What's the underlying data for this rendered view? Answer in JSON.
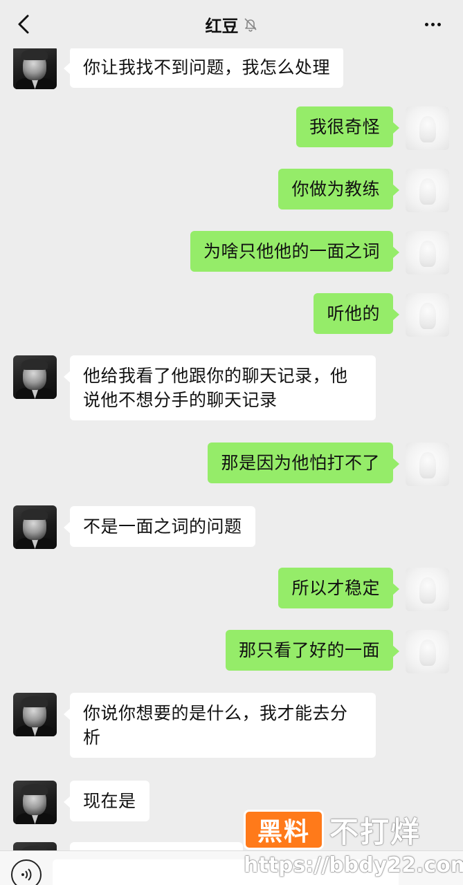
{
  "header": {
    "title": "红豆",
    "back_icon": "chevron-left-icon",
    "mute_icon": "bell-slash-icon",
    "more_icon": "more-dots-icon"
  },
  "colors": {
    "background": "#ededed",
    "incoming_bubble": "#ffffff",
    "outgoing_bubble": "#95ec69",
    "watermark_orange": "#ff7a1a"
  },
  "messages": [
    {
      "side": "left",
      "text": "你让我找不到问题，我怎么处理"
    },
    {
      "side": "right",
      "text": "我很奇怪"
    },
    {
      "side": "right",
      "text": "你做为教练"
    },
    {
      "side": "right",
      "text": "为啥只他他的一面之词"
    },
    {
      "side": "right",
      "text": "听他的"
    },
    {
      "side": "left",
      "text": "他给我看了他跟你的聊天记录，他说他不想分手的聊天记录"
    },
    {
      "side": "right",
      "text": "那是因为他怕打不了"
    },
    {
      "side": "left",
      "text": "不是一面之词的问题"
    },
    {
      "side": "right",
      "text": "所以才稳定"
    },
    {
      "side": "right",
      "text": "那只看了好的一面"
    },
    {
      "side": "left",
      "text": "你说你想要的是什么，我才能去分析"
    },
    {
      "side": "left",
      "text": "现在是"
    }
  ],
  "bottom_bar": {
    "voice_icon": "voice-icon"
  },
  "watermark": {
    "badge": "黑料",
    "text": "不打烊",
    "url": "https://bbdy22.com"
  }
}
